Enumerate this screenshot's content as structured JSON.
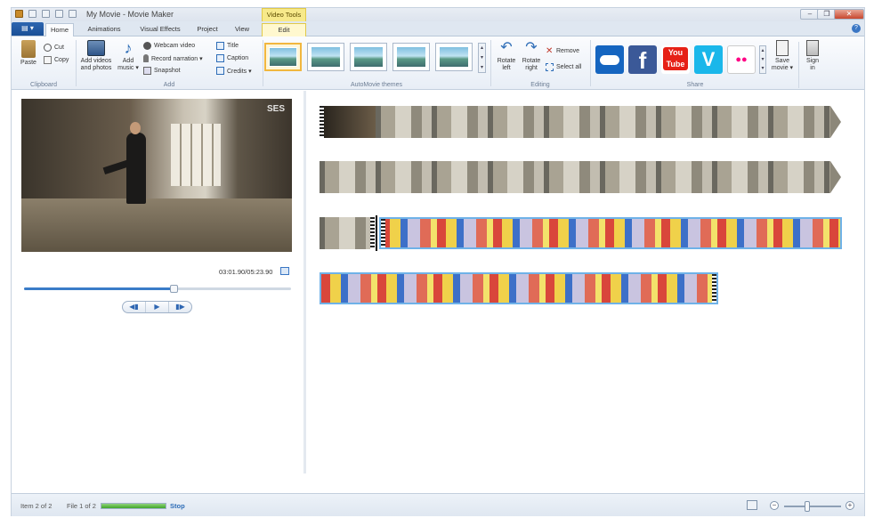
{
  "window": {
    "title": "My Movie - Movie Maker",
    "contextual_tab_group": "Video Tools",
    "minimize_label": "‒",
    "maximize_label": "❐",
    "close_label": "✕"
  },
  "tabs": {
    "file_label": "▤ ▾",
    "items": [
      "Home",
      "Animations",
      "Visual Effects",
      "Project",
      "View",
      "Edit"
    ],
    "active": "Home",
    "help_label": "?"
  },
  "ribbon": {
    "clipboard": {
      "label": "Clipboard",
      "paste": "Paste",
      "cut": "Cut",
      "copy": "Copy"
    },
    "add": {
      "label": "Add",
      "add_videos_line1": "Add videos",
      "add_videos_line2": "and photos",
      "add_music_line1": "Add",
      "add_music_line2": "music ▾",
      "webcam_video": "Webcam video",
      "record_narration": "Record narration ▾",
      "snapshot": "Snapshot",
      "title": "Title",
      "caption": "Caption",
      "credits": "Credits ▾"
    },
    "themes": {
      "label": "AutoMovie themes"
    },
    "editing": {
      "label": "Editing",
      "rotate_left_line1": "Rotate",
      "rotate_left_line2": "left",
      "rotate_right_line1": "Rotate",
      "rotate_right_line2": "right",
      "remove": "Remove",
      "select_all": "Select all"
    },
    "share": {
      "label": "Share",
      "services": [
        "onedrive",
        "facebook",
        "youtube",
        "vimeo",
        "flickr"
      ],
      "youtube_text": "You Tube",
      "facebook_text": "f",
      "vimeo_text": "V",
      "flickr_text": "●●",
      "save_movie_line1": "Save",
      "save_movie_line2": "movie ▾",
      "sign_in_line1": "Sign",
      "sign_in_line2": "in"
    }
  },
  "preview": {
    "watermark": "SES",
    "timecode": "03:01.90/05:23.90",
    "seek_fraction": 0.56,
    "controls": {
      "prev": "◀▮",
      "play": "▶",
      "next": "▮▶"
    }
  },
  "status": {
    "item": "Item 2 of 2",
    "file": "File 1 of 2",
    "progress_fraction": 1.0,
    "stop": "Stop",
    "zoom_minus": "−",
    "zoom_plus": "+",
    "zoom_fraction": 0.4
  },
  "colors": {
    "accent": "#3a7cc8",
    "file_tab": "#1a4f96",
    "contextual": "#f7e98a",
    "onedrive": "#1565c0",
    "facebook": "#3b5998",
    "youtube": "#e62117",
    "vimeo": "#1ab7ea"
  }
}
